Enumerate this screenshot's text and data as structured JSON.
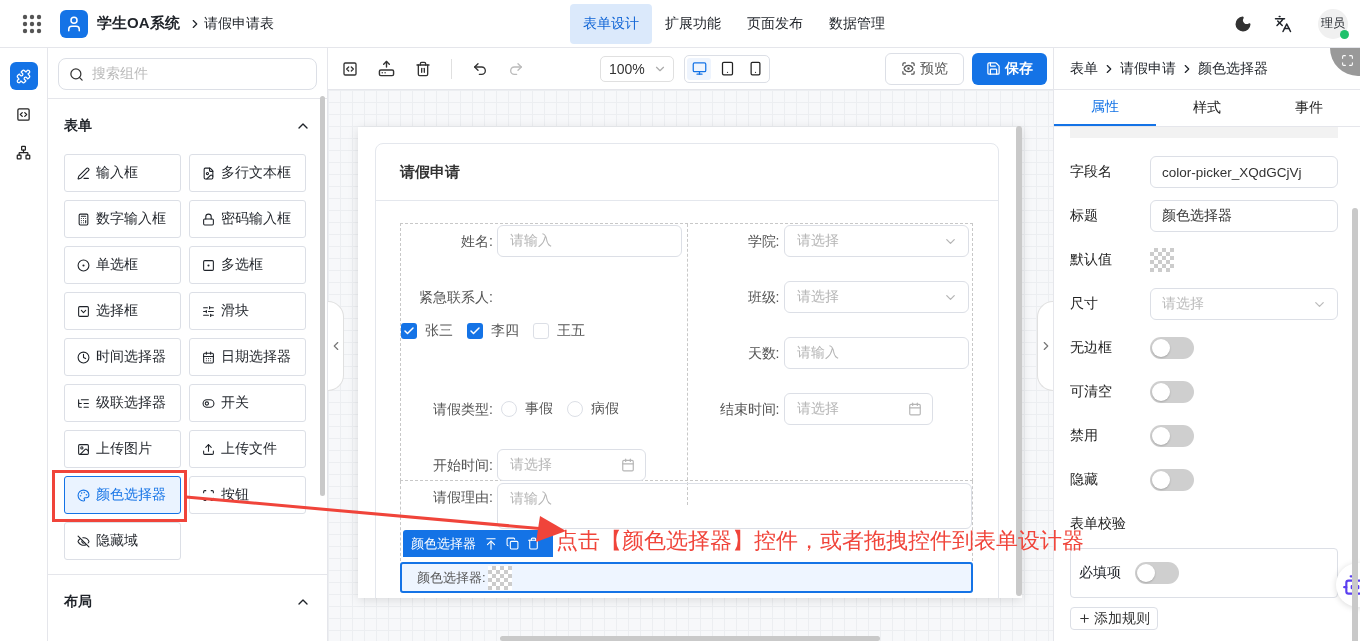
{
  "topbar": {
    "brand": "学生OA系统",
    "breadcrumb": "请假申请表",
    "avatar": "理员",
    "nav": [
      {
        "label": "表单设计",
        "selected": true
      },
      {
        "label": "扩展功能",
        "selected": false
      },
      {
        "label": "页面发布",
        "selected": false
      },
      {
        "label": "数据管理",
        "selected": false
      }
    ]
  },
  "rail": [
    {
      "kind": "components",
      "selected": true
    },
    {
      "kind": "code",
      "selected": false
    },
    {
      "kind": "tree",
      "selected": false
    }
  ],
  "palette": {
    "search_placeholder": "搜索组件",
    "sections": [
      {
        "title": "表单",
        "expanded": true,
        "items": [
          {
            "kind": "input",
            "label": "输入框",
            "selected": false
          },
          {
            "kind": "textarea",
            "label": "多行文本框",
            "selected": false
          },
          {
            "kind": "number",
            "label": "数字输入框",
            "selected": false
          },
          {
            "kind": "password",
            "label": "密码输入框",
            "selected": false
          },
          {
            "kind": "radio",
            "label": "单选框",
            "selected": false
          },
          {
            "kind": "checkbox",
            "label": "多选框",
            "selected": false
          },
          {
            "kind": "select",
            "label": "选择框",
            "selected": false
          },
          {
            "kind": "slider",
            "label": "滑块",
            "selected": false
          },
          {
            "kind": "time",
            "label": "时间选择器",
            "selected": false
          },
          {
            "kind": "date",
            "label": "日期选择器",
            "selected": false
          },
          {
            "kind": "cascader",
            "label": "级联选择器",
            "selected": false
          },
          {
            "kind": "switch",
            "label": "开关",
            "selected": false
          },
          {
            "kind": "image",
            "label": "上传图片",
            "selected": false
          },
          {
            "kind": "file",
            "label": "上传文件",
            "selected": false
          },
          {
            "kind": "color",
            "label": "颜色选择器",
            "selected": true
          },
          {
            "kind": "button",
            "label": "按钮",
            "selected": false
          },
          {
            "kind": "hidden",
            "label": "隐藏域",
            "selected": false
          }
        ]
      },
      {
        "title": "布局",
        "expanded": true
      }
    ]
  },
  "toolbar": {
    "zoom": "100%",
    "devices": [
      {
        "kind": "desktop",
        "selected": true
      },
      {
        "kind": "tablet",
        "selected": false
      },
      {
        "kind": "phone",
        "selected": false
      }
    ],
    "preview": "预览",
    "save": "保存"
  },
  "form": {
    "title": "请假申请",
    "columns": [
      [
        {
          "kind": "input",
          "label": "姓名:",
          "placeholder": "请输入"
        },
        {
          "kind": "checkboxes",
          "label": "紧急联系人:",
          "options": [
            {
              "label": "张三",
              "checked": true
            },
            {
              "label": "李四",
              "checked": true
            },
            {
              "label": "王五",
              "checked": false
            }
          ]
        },
        {
          "kind": "radios",
          "label": "请假类型:",
          "options": [
            {
              "label": "事假",
              "selected": false
            },
            {
              "label": "病假",
              "selected": false
            }
          ]
        },
        {
          "kind": "date",
          "label": "开始时间:",
          "placeholder": "请选择"
        }
      ],
      [
        {
          "kind": "select",
          "label": "学院:",
          "placeholder": "请选择"
        },
        {
          "kind": "select",
          "label": "班级:",
          "placeholder": "请选择"
        },
        {
          "kind": "input",
          "label": "天数:",
          "placeholder": "请输入"
        },
        {
          "kind": "date",
          "label": "结束时间:",
          "placeholder": "请选择"
        }
      ]
    ],
    "reason": {
      "label": "请假理由:",
      "placeholder": "请输入"
    },
    "selected_widget": {
      "tag": "颜色选择器",
      "label": "颜色选择器:"
    }
  },
  "inspector": {
    "breadcrumb": [
      "表单",
      "请假申请",
      "颜色选择器"
    ],
    "tabs": [
      {
        "label": "属性",
        "selected": true
      },
      {
        "label": "样式",
        "selected": false
      },
      {
        "label": "事件",
        "selected": false
      }
    ],
    "props": [
      {
        "kind": "input",
        "label": "字段名",
        "value": "color-picker_XQdGCjVj"
      },
      {
        "kind": "input",
        "label": "标题",
        "value": "颜色选择器"
      },
      {
        "kind": "color",
        "label": "默认值"
      },
      {
        "kind": "select",
        "label": "尺寸",
        "placeholder": "请选择"
      },
      {
        "kind": "switch",
        "label": "无边框",
        "on": false
      },
      {
        "kind": "switch",
        "label": "可清空",
        "on": false
      },
      {
        "kind": "switch",
        "label": "禁用",
        "on": false
      },
      {
        "kind": "switch",
        "label": "隐藏",
        "on": false
      }
    ],
    "validation": {
      "title": "表单校验",
      "rule": {
        "label": "必填项",
        "on": false
      },
      "add": "添加规则"
    }
  },
  "callout": {
    "text": "点击【颜色选择器】控件，或者拖拽控件到表单设计器"
  }
}
